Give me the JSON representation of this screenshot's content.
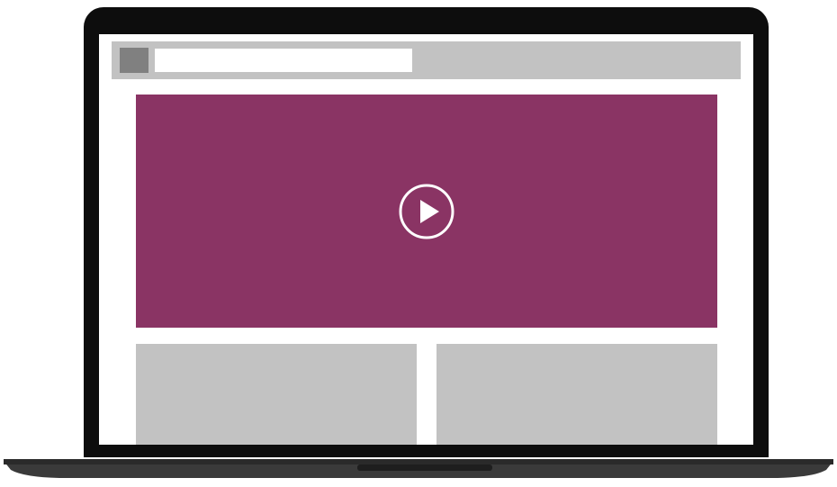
{
  "browser": {
    "address_value": "",
    "address_placeholder": ""
  },
  "video": {
    "background_color": "#8a3464",
    "play_icon": "play-icon",
    "play_icon_color": "#ffffff"
  },
  "placeholder_color": "#c2c2c2",
  "cards": [
    {
      "label": ""
    },
    {
      "label": ""
    }
  ],
  "icons": {
    "favicon": "favicon-icon"
  }
}
